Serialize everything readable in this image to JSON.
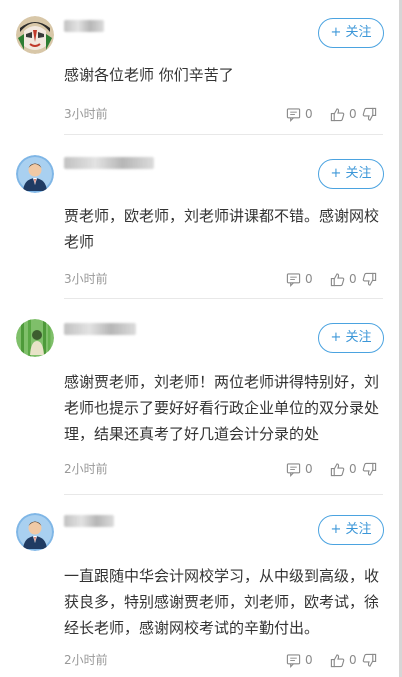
{
  "follow_label": "+ 关注",
  "comments": [
    {
      "avatar": "opera-mask-avatar",
      "content": "感谢各位老师  你们辛苦了",
      "time": "3小时前",
      "reply_count": "0",
      "like_count": "0"
    },
    {
      "avatar": "person-suit-avatar",
      "content": "贾老师，欧老师，刘老师讲课都不错。感谢网校老师",
      "time": "3小时前",
      "reply_count": "0",
      "like_count": "0"
    },
    {
      "avatar": "bamboo-scene-avatar",
      "content": "感谢贾老师，刘老师！两位老师讲得特别好，刘老师也提示了要好好看行政企业单位的双分录处理，结果还真考了好几道会计分录的处",
      "time": "2小时前",
      "reply_count": "0",
      "like_count": "0"
    },
    {
      "avatar": "person-suit-avatar",
      "content": "一直跟随中华会计网校学习，从中级到高级，收获良多，特别感谢贾老师，刘老师，欧考试，徐经长老师，感谢网校考试的辛勤付出。",
      "time": "2小时前",
      "reply_count": "0",
      "like_count": "0"
    }
  ]
}
